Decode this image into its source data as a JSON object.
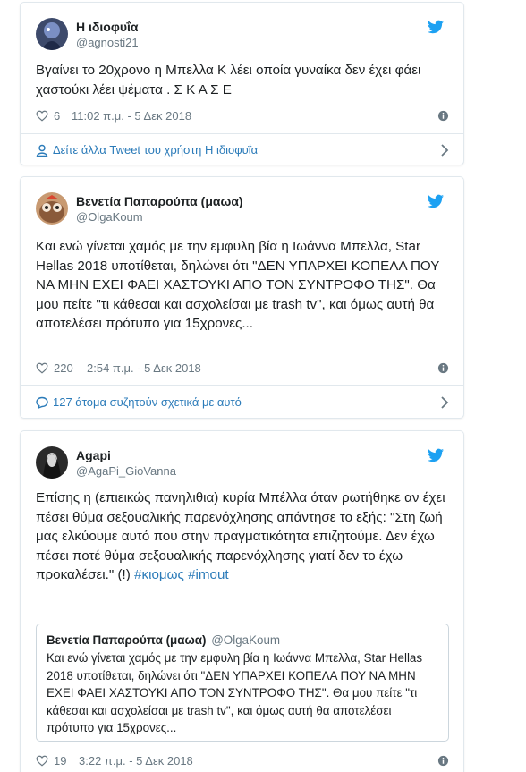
{
  "tweets": [
    {
      "author": {
        "name": "Η ιδιοφυΐα",
        "handle": "@agnosti21"
      },
      "text": "Βγαίνει το 20χρονο η Μπελλα Κ λέει οποία γυναίκα δεν έχει φάει χαστούκι λέει ψέματα . Σ Κ Α Σ Ε",
      "likes": "6",
      "timestamp": "11:02 π.μ. - 5 Δεκ 2018",
      "footer": "Δείτε άλλα Tweet του χρήστη Η ιδιοφυΐα"
    },
    {
      "author": {
        "name": "Βενετία Παπαρούπα (μαωα)",
        "handle": "@OlgaKoum"
      },
      "text": "Και ενώ γίνεται χαμός με την εμφυλη βία η Ιωάννα Μπελλα, Star Hellas 2018 υποτίθεται, δηλώνει ότι \"ΔΕΝ ΥΠΑΡΧΕΙ ΚΟΠΕΛΑ ΠΟΥ ΝΑ ΜΗΝ ΕΧΕΙ ΦΑΕΙ ΧΑΣΤΟΥΚΙ ΑΠΟ ΤΟΝ ΣΥΝΤΡΟΦΟ ΤΗΣ\". Θα μου πείτε \"τι κάθεσαι και ασχολείσαι με trash tv\", και όμως αυτή θα αποτελέσει πρότυπο για 15χρονες...",
      "likes": "220",
      "timestamp": "2:54 π.μ. - 5 Δεκ 2018",
      "footer": "127 άτομα συζητούν σχετικά με αυτό"
    },
    {
      "author": {
        "name": "Agapi",
        "handle": "@AgaPi_GioVanna"
      },
      "text_main": "Επίσης η (επιεικώς πανηλιθια) κυρία Μπέλλα όταν ρωτήθηκε αν έχει πέσει θύμα σεξουαλικής παρενόχλησης απάντησε το εξής: \"Στη ζωή μας ελκύουμε αυτό που στην πραγματικότητα επιζητούμε. Δεν έχω πέσει ποτέ θύμα σεξουαλικής παρενόχλησης γιατί δεν το έχω προκαλέσει.\" (!) ",
      "hashtag_1": "#κιομως",
      "hashtag_2": "#imout",
      "quote": {
        "name": "Βενετία Παπαρούπα (μαωα)",
        "handle": "@OlgaKoum",
        "text": "Και ενώ γίνεται χαμός με την εμφυλη βία η Ιωάννα Μπελλα, Star Hellas 2018 υποτίθεται, δηλώνει ότι \"ΔΕΝ ΥΠΑΡΧΕΙ ΚΟΠΕΛΑ ΠΟΥ ΝΑ ΜΗΝ ΕΧΕΙ ΦΑΕΙ ΧΑΣΤΟΥΚΙ ΑΠΟ ΤΟΝ ΣΥΝΤΡΟΦΟ ΤΗΣ\". Θα μου πείτε \"τι κάθεσαι και ασχολείσαι με trash tv\", και όμως αυτή θα αποτελέσει πρότυπο για 15χρονες..."
      },
      "likes": "19",
      "timestamp": "3:22 π.μ. - 5 Δεκ 2018"
    }
  ],
  "colors": {
    "link": "#2b7bb9",
    "muted": "#697882",
    "border": "#e1e8ed",
    "twitter_blue": "#1da1f2"
  },
  "icons": [
    "twitter-bird-icon",
    "heart-icon",
    "info-icon",
    "user-icon",
    "comment-icon",
    "chevron-right-icon"
  ]
}
